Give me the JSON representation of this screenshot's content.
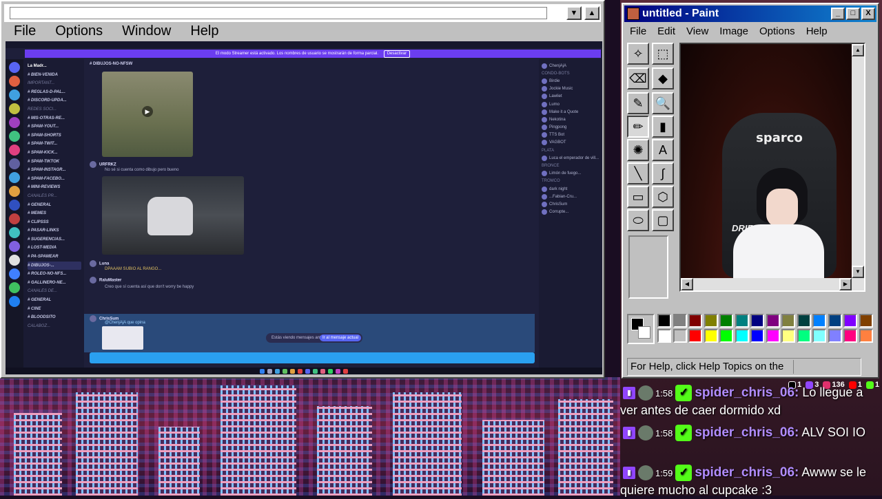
{
  "app": {
    "menu": [
      "File",
      "Options",
      "Window",
      "Help"
    ],
    "btn_down": "▼",
    "btn_up": "▲"
  },
  "discord": {
    "banner": "El modo Streamer está activado. Los nombres de usuario se mostrarán de forma parcial.",
    "banner_button": "Desactivar",
    "server_name": "La Madr...",
    "channel_header": "# DIBUJOS-NO-NFSW",
    "channels": [
      {
        "label": "# BIEN-VENIDA",
        "type": "ch"
      },
      {
        "label": "IMPORTANT...",
        "type": "cat"
      },
      {
        "label": "# REGLAS-D-PAL...",
        "type": "ch"
      },
      {
        "label": "# DISCORD-UPDA...",
        "type": "ch"
      },
      {
        "label": "REDES SOCI...",
        "type": "cat"
      },
      {
        "label": "# MIS-OTRAS-RE...",
        "type": "ch"
      },
      {
        "label": "# SPAM-YOUT...",
        "type": "ch"
      },
      {
        "label": "# SPAM-SHORTS",
        "type": "ch"
      },
      {
        "label": "# SPAM-TWIT...",
        "type": "ch"
      },
      {
        "label": "# SPAM-KICK...",
        "type": "ch"
      },
      {
        "label": "# SPAM-TIKTOK",
        "type": "ch"
      },
      {
        "label": "# SPAM-INSTAGR...",
        "type": "ch"
      },
      {
        "label": "# SPAM-FACEBO...",
        "type": "ch"
      },
      {
        "label": "# MINI-REVIEWS",
        "type": "ch"
      },
      {
        "label": "CANALES PR...",
        "type": "cat"
      },
      {
        "label": "# GENERAL",
        "type": "ch"
      },
      {
        "label": "# MEMES",
        "type": "ch"
      },
      {
        "label": "# CLIPSSS",
        "type": "ch"
      },
      {
        "label": "# PASAR-LINKS",
        "type": "ch"
      },
      {
        "label": "# SUGERENCIAS...",
        "type": "ch"
      },
      {
        "label": "# LOST-MEDIA",
        "type": "ch"
      },
      {
        "label": "# PA-SPAMEAR",
        "type": "ch"
      },
      {
        "label": "# DIBUJOS-...",
        "type": "active"
      },
      {
        "label": "# ROLEO-NO-NFS...",
        "type": "ch"
      },
      {
        "label": "# GALLINERO-NE...",
        "type": "ch"
      },
      {
        "label": "CANALES DE...",
        "type": "cat"
      },
      {
        "label": "# GENERAL",
        "type": "ch"
      },
      {
        "label": "# CINE",
        "type": "ch"
      },
      {
        "label": "# BLOODSITO",
        "type": "ch"
      },
      {
        "label": "CALABOZ...",
        "type": "cat"
      }
    ],
    "messages": {
      "m1_name": "URFRKZ",
      "m1_text": "No sé si cuenta como dibujo pero bueno",
      "m2_name": "Luna",
      "m2_text": "DPAAAM SUBIO AL RANGO...",
      "m3_name": "RaluMaster",
      "m3_text": "Creo que sí cuenta así que don't worry be happy",
      "m4_name": "ChrisSum",
      "m4_text": "@ChenjAjA que opina"
    },
    "jump_text": "Estás viendo mensajes antiguos",
    "jump_button": "Ir al mensaje actual",
    "members": [
      "ChenjAjA",
      "CONDO-BOTS",
      "Birdie",
      "Jockie Music",
      "Lawliet",
      "Lumo",
      "Make it a Quote",
      "Nekotina",
      "Pingpong",
      "TTS Bot",
      "VAGBOT",
      "PLATA",
      "Luca el emperador de vill...",
      "BRONCE",
      "Limón de fuego...",
      "TROMCO",
      "dark night",
      "...Fabian-Cru...",
      "ChrisSum",
      "Corrupte..."
    ]
  },
  "paint": {
    "title": "untitled - Paint",
    "menu": [
      "File",
      "Edit",
      "View",
      "Image",
      "Options",
      "Help"
    ],
    "tools": [
      "✧",
      "⬚",
      "⌫",
      "◆",
      "✎",
      "🔍",
      "✏",
      "▮",
      "✺",
      "A",
      "╲",
      "∫",
      "▭",
      "⬡",
      "⬭",
      "▢"
    ],
    "status": "For Help, click Help Topics on the",
    "chair_brand": "sparco",
    "chair_side": "DRIF",
    "palette_top": [
      "#000000",
      "#808080",
      "#800000",
      "#808000",
      "#008000",
      "#008080",
      "#000080",
      "#800080",
      "#808040",
      "#004040",
      "#0080ff",
      "#004080",
      "#8000ff",
      "#804000"
    ],
    "palette_bottom": [
      "#ffffff",
      "#c0c0c0",
      "#ff0000",
      "#ffff00",
      "#00ff00",
      "#00ffff",
      "#0000ff",
      "#ff00ff",
      "#ffff80",
      "#00ff80",
      "#80ffff",
      "#8080ff",
      "#ff0080",
      "#ff8040"
    ],
    "buttons": {
      "min": "_",
      "max": "□",
      "close": "X"
    },
    "scroll_up": "▲",
    "scroll_down": "▼",
    "scroll_left": "◀",
    "scroll_right": "▶"
  },
  "chat": {
    "stats": {
      "tiktok": "1",
      "chat": "3",
      "instagram": "136",
      "youtube": "1",
      "kick": "1"
    },
    "messages": [
      {
        "time": "1:58",
        "user": "spider_chris_06:",
        "text": "Lo llegue a ver antes de caer dormido xd"
      },
      {
        "time": "1:58",
        "user": "spider_chris_06:",
        "text": "ALV SOI IO"
      },
      {
        "time": "1:59",
        "user": "spider_chris_06:",
        "text": "Awww se le quiere mucho al cupcake :3"
      }
    ]
  }
}
